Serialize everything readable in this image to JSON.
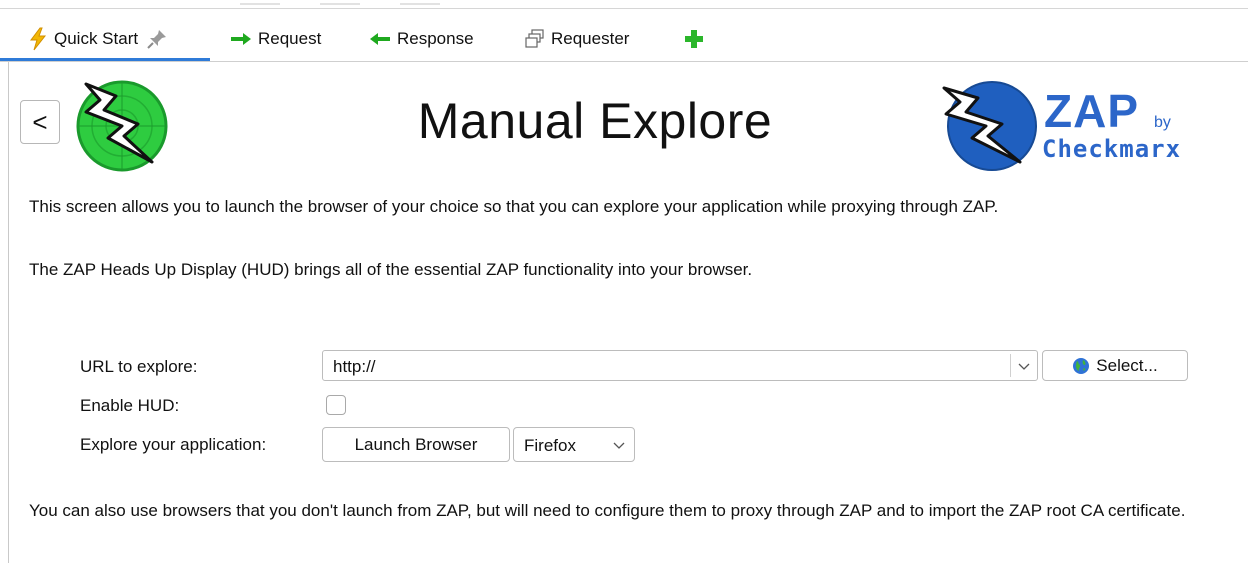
{
  "tabs": [
    {
      "label": "Quick Start",
      "icon": "lightning-icon",
      "active": true
    },
    {
      "label": "Request",
      "icon": "arrow-right-icon"
    },
    {
      "label": "Response",
      "icon": "arrow-left-icon"
    },
    {
      "label": "Requester",
      "icon": "windows-icon"
    }
  ],
  "add_tab_icon": "plus-icon",
  "pin_icon": "pin-icon",
  "header": {
    "back_label": "<",
    "title": "Manual Explore",
    "brand_zap": "ZAP",
    "brand_by": "by",
    "brand_company": "Checkmarx"
  },
  "paragraphs": {
    "intro": "This screen allows you to launch the browser of your choice so that you can explore your application while proxying through ZAP.",
    "hud": "The ZAP Heads Up Display (HUD) brings all of the essential ZAP functionality into your browser.",
    "footer": "You can also use browsers that you don't launch from ZAP, but will need to configure them to proxy through ZAP and to import the ZAP root CA certificate."
  },
  "form": {
    "url_label": "URL to explore:",
    "url_value": "http://",
    "select_label": "Select...",
    "hud_label": "Enable HUD:",
    "hud_checked": false,
    "explore_label": "Explore your application:",
    "launch_label": "Launch Browser",
    "browser_value": "Firefox"
  },
  "colors": {
    "accent": "#2f7bd8",
    "zap_blue": "#2c66c9",
    "plus_green": "#2bb62b",
    "arrow_green": "#1fa91f",
    "lightning_yellow": "#f2b705"
  }
}
